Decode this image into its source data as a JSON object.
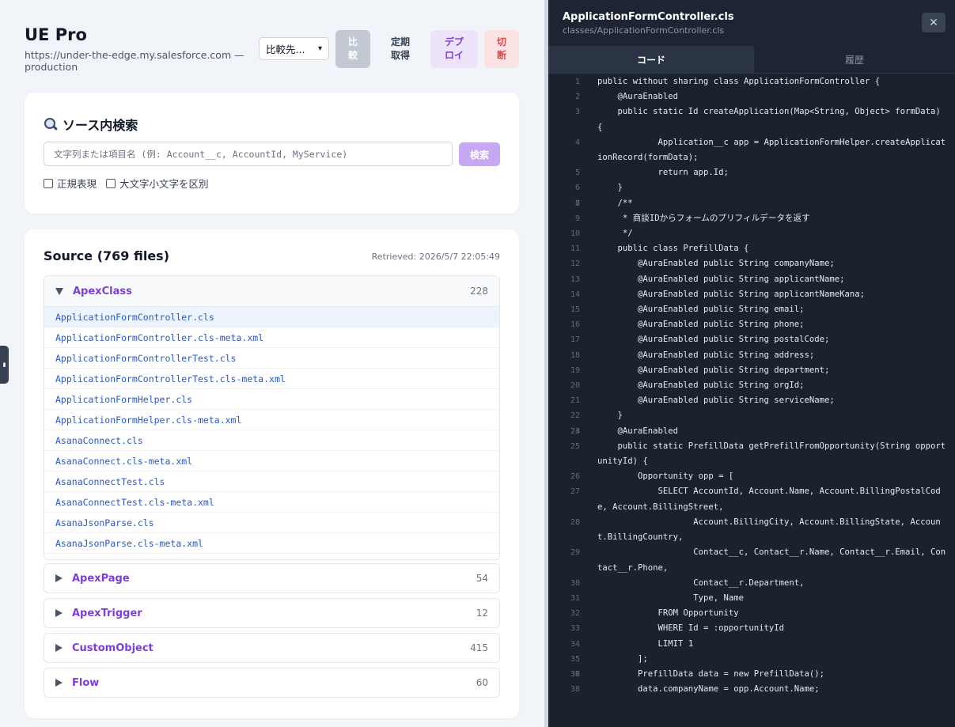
{
  "header": {
    "title": "UE Pro",
    "url": "https://under-the-edge.my.salesforce.com — production",
    "compare_select": "比較先...",
    "buttons": {
      "compare_line1": "比",
      "compare_line2": "較",
      "fetch_line1": "定期",
      "fetch_line2": "取得",
      "deploy_line1": "デプ",
      "deploy_line2": "ロイ",
      "cut_line1": "切",
      "cut_line2": "断"
    }
  },
  "search": {
    "title": "ソース内検索",
    "placeholder": "文字列または項目名 (例: Account__c, AccountId, MyService)",
    "button": "検索",
    "regex_label": "正規表現",
    "case_label": "大文字小文字を区別"
  },
  "source": {
    "title": "Source (769 files)",
    "retrieved": "Retrieved: 2026/5/7 22:05:49",
    "open_group": {
      "name": "ApexClass",
      "count": "228",
      "files": [
        "ApplicationFormController.cls",
        "ApplicationFormController.cls-meta.xml",
        "ApplicationFormControllerTest.cls",
        "ApplicationFormControllerTest.cls-meta.xml",
        "ApplicationFormHelper.cls",
        "ApplicationFormHelper.cls-meta.xml",
        "AsanaConnect.cls",
        "AsanaConnect.cls-meta.xml",
        "AsanaConnectTest.cls",
        "AsanaConnectTest.cls-meta.xml",
        "AsanaJsonParse.cls",
        "AsanaJsonParse.cls-meta.xml"
      ]
    },
    "groups": [
      {
        "name": "ApexPage",
        "count": "54"
      },
      {
        "name": "ApexTrigger",
        "count": "12"
      },
      {
        "name": "CustomObject",
        "count": "415"
      },
      {
        "name": "Flow",
        "count": "60"
      }
    ]
  },
  "viewer": {
    "title": "ApplicationFormController.cls",
    "path": "classes/ApplicationFormController.cls",
    "close": "✕",
    "tab_code": "コード",
    "tab_history": "履歴",
    "lines": [
      {
        "n": "1",
        "t": "public without sharing class ApplicationFormController {"
      },
      {
        "n": "2",
        "t": "    @AuraEnabled"
      },
      {
        "n": "3",
        "t": "    public static Id createApplication(Map<String, Object> formData) {"
      },
      {
        "n": "4",
        "t": "            Application__c app = ApplicationFormHelper.createApplicationRecord(formData);"
      },
      {
        "n": "5",
        "t": "            return app.Id;"
      },
      {
        "n": "6",
        "t": "    }"
      },
      {
        "n": "7",
        "t": ""
      },
      {
        "n": "8",
        "t": "    /**"
      },
      {
        "n": "9",
        "t": "     * 商談IDからフォームのプリフィルデータを返す"
      },
      {
        "n": "10",
        "t": "     */"
      },
      {
        "n": "11",
        "t": "    public class PrefillData {"
      },
      {
        "n": "12",
        "t": "        @AuraEnabled public String companyName;"
      },
      {
        "n": "13",
        "t": "        @AuraEnabled public String applicantName;"
      },
      {
        "n": "14",
        "t": "        @AuraEnabled public String applicantNameKana;"
      },
      {
        "n": "15",
        "t": "        @AuraEnabled public String email;"
      },
      {
        "n": "16",
        "t": "        @AuraEnabled public String phone;"
      },
      {
        "n": "17",
        "t": "        @AuraEnabled public String postalCode;"
      },
      {
        "n": "18",
        "t": "        @AuraEnabled public String address;"
      },
      {
        "n": "19",
        "t": "        @AuraEnabled public String department;"
      },
      {
        "n": "20",
        "t": "        @AuraEnabled public String orgId;"
      },
      {
        "n": "21",
        "t": "        @AuraEnabled public String serviceName;"
      },
      {
        "n": "22",
        "t": "    }"
      },
      {
        "n": "23",
        "t": ""
      },
      {
        "n": "24",
        "t": "    @AuraEnabled"
      },
      {
        "n": "25",
        "t": "    public static PrefillData getPrefillFromOpportunity(String opportunityId) {"
      },
      {
        "n": "26",
        "t": "        Opportunity opp = ["
      },
      {
        "n": "27",
        "t": "            SELECT AccountId, Account.Name, Account.BillingPostalCode, Account.BillingStreet,"
      },
      {
        "n": "28",
        "t": "                   Account.BillingCity, Account.BillingState, Account.BillingCountry,"
      },
      {
        "n": "29",
        "t": "                   Contact__c, Contact__r.Name, Contact__r.Email, Contact__r.Phone,"
      },
      {
        "n": "30",
        "t": "                   Contact__r.Department,"
      },
      {
        "n": "31",
        "t": "                   Type, Name"
      },
      {
        "n": "32",
        "t": "            FROM Opportunity"
      },
      {
        "n": "33",
        "t": "            WHERE Id = :opportunityId"
      },
      {
        "n": "34",
        "t": "            LIMIT 1"
      },
      {
        "n": "35",
        "t": "        ];"
      },
      {
        "n": "36",
        "t": ""
      },
      {
        "n": "37",
        "t": "        PrefillData data = new PrefillData();"
      },
      {
        "n": "38",
        "t": "        data.companyName = opp.Account.Name;"
      }
    ]
  }
}
